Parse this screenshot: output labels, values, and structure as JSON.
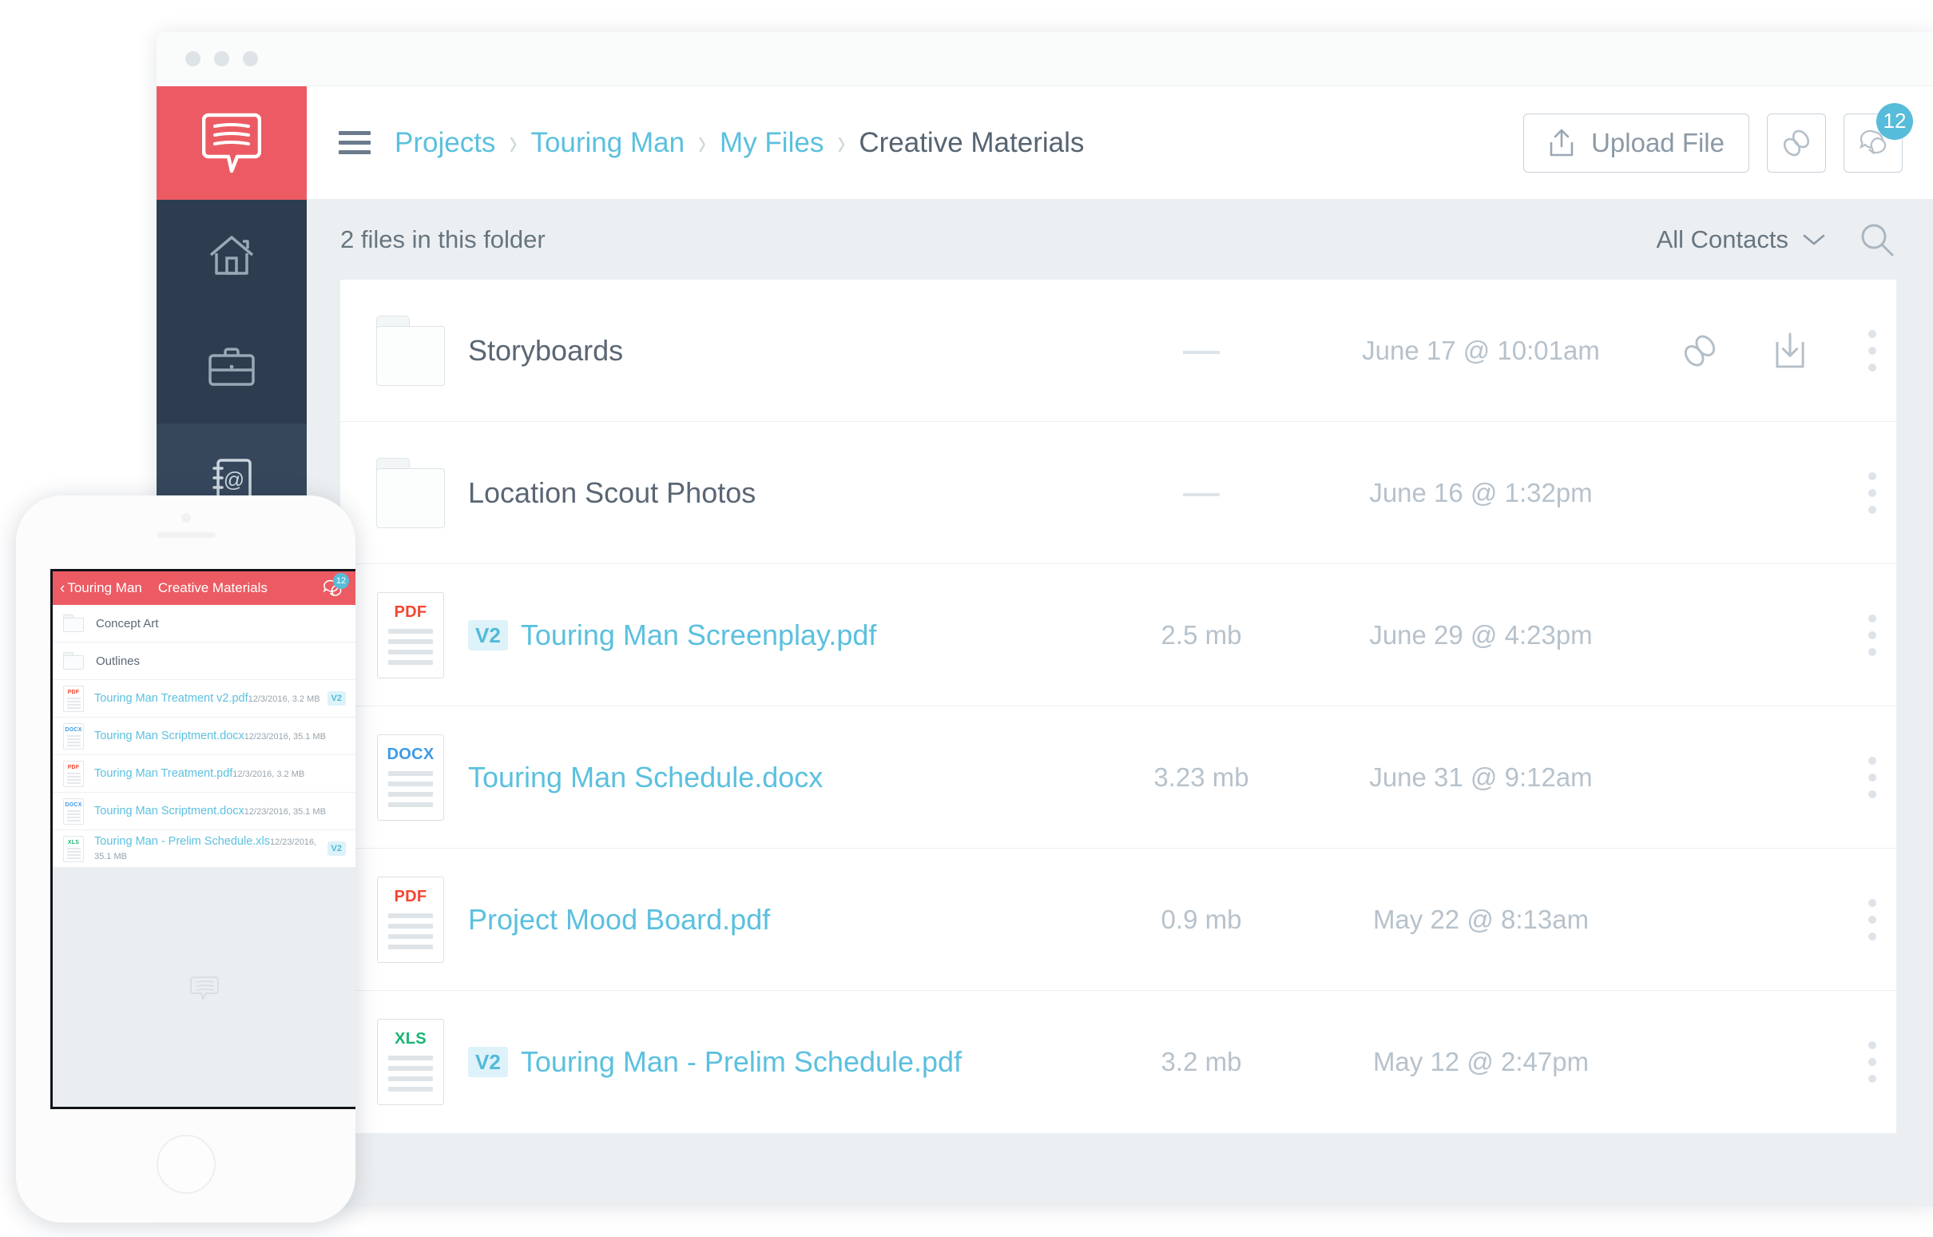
{
  "desktop": {
    "logo_icon": "speech-bubble-logo",
    "sidebar": {
      "items": [
        {
          "icon": "home-icon",
          "name": "home",
          "active": false
        },
        {
          "icon": "briefcase-icon",
          "name": "projects",
          "active": false
        },
        {
          "icon": "contacts-book-icon",
          "name": "contacts",
          "active": true
        }
      ]
    },
    "topbar": {
      "menu_icon": "hamburger-menu-icon",
      "breadcrumbs": [
        {
          "label": "Projects",
          "current": false
        },
        {
          "label": "Touring Man",
          "current": false
        },
        {
          "label": "My Files",
          "current": false
        },
        {
          "label": "Creative Materials",
          "current": true
        }
      ],
      "separator": "›",
      "upload_label": "Upload File",
      "upload_icon": "upload-icon",
      "link_icon": "link-icon",
      "chat_icon": "chat-bubble-icon",
      "chat_badge": "12"
    },
    "subbar": {
      "file_count_text": "2 files in this folder",
      "contacts_filter_label": "All Contacts",
      "chevron_icon": "chevron-down-icon",
      "search_icon": "search-icon"
    },
    "rows": [
      {
        "kind": "folder",
        "name": "Storyboards",
        "version": "",
        "size": "—",
        "date": "June 17 @ 10:01am",
        "ext": "",
        "hover": true
      },
      {
        "kind": "folder",
        "name": "Location Scout Photos",
        "version": "",
        "size": "—",
        "date": "June 16 @ 1:32pm",
        "ext": "",
        "hover": false
      },
      {
        "kind": "file",
        "name": "Touring Man Screenplay.pdf",
        "version": "V2",
        "size": "2.5 mb",
        "date": "June 29 @ 4:23pm",
        "ext": "PDF",
        "hover": false
      },
      {
        "kind": "file",
        "name": "Touring Man Schedule.docx",
        "version": "",
        "size": "3.23 mb",
        "date": "June 31 @ 9:12am",
        "ext": "DOCX",
        "hover": false
      },
      {
        "kind": "file",
        "name": "Project Mood Board.pdf",
        "version": "",
        "size": "0.9 mb",
        "date": "May 22 @ 8:13am",
        "ext": "PDF",
        "hover": false
      },
      {
        "kind": "file",
        "name": "Touring Man - Prelim Schedule.pdf",
        "version": "V2",
        "size": "3.2 mb",
        "date": "May 12 @ 2:47pm",
        "ext": "XLS",
        "hover": false
      }
    ],
    "row_action_icons": {
      "link": "link-icon",
      "download": "download-icon",
      "more": "more-options-icon"
    }
  },
  "phone": {
    "header": {
      "back_icon": "back-chevron-icon",
      "parent_label": "Touring Man",
      "title": "Creative Materials",
      "chat_icon": "chat-bubble-icon",
      "chat_badge": "12"
    },
    "rows": [
      {
        "kind": "folder",
        "name": "Concept Art",
        "sub": "",
        "ext": "",
        "version": ""
      },
      {
        "kind": "folder",
        "name": "Outlines",
        "sub": "",
        "ext": "",
        "version": ""
      },
      {
        "kind": "file",
        "name": "Touring Man Treatment v2.pdf",
        "sub": "12/3/2016, 3.2 MB",
        "ext": "PDF",
        "version": "V2"
      },
      {
        "kind": "file",
        "name": "Touring Man Scriptment.docx",
        "sub": "12/23/2016, 35.1 MB",
        "ext": "DOCX",
        "version": ""
      },
      {
        "kind": "file",
        "name": "Touring Man Treatment.pdf",
        "sub": "12/3/2016, 3.2 MB",
        "ext": "PDF",
        "version": ""
      },
      {
        "kind": "file",
        "name": "Touring Man Scriptment.docx",
        "sub": "12/23/2016, 35.1 MB",
        "ext": "DOCX",
        "version": ""
      },
      {
        "kind": "file",
        "name": "Touring Man - Prelim Schedule.xls",
        "sub": "12/23/2016, 35.1 MB",
        "ext": "XLS",
        "version": "V2"
      }
    ],
    "footer_icon": "speech-bubble-icon"
  },
  "colors": {
    "accent_red": "#ec5b63",
    "link_blue": "#5bc0de",
    "badge_teal": "#57bcd9",
    "sidebar_dark": "#2d3c4f",
    "pdf_red": "#f4452f",
    "docx_blue": "#3d9ae8",
    "xls_green": "#18b573"
  }
}
